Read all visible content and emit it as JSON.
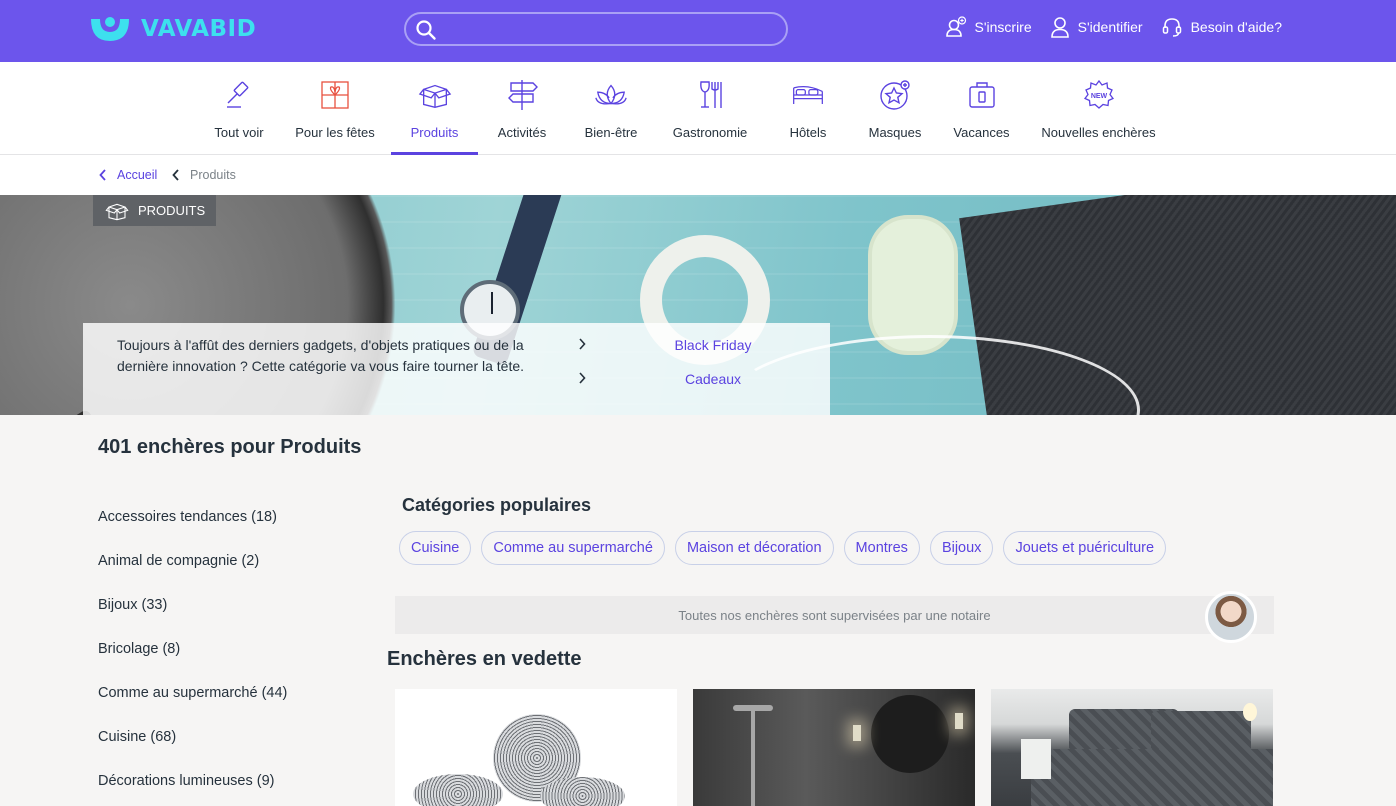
{
  "header": {
    "brand": "VAVABID",
    "search": {
      "value": "",
      "placeholder": ""
    },
    "actions": [
      {
        "label": "S'inscrire",
        "icon": "user-plus-icon"
      },
      {
        "label": "S'identifier",
        "icon": "user-icon"
      },
      {
        "label": "Besoin d'aide?",
        "icon": "headset-icon"
      }
    ]
  },
  "categories": [
    {
      "label": "Tout voir",
      "icon": "gavel-icon"
    },
    {
      "label": "Pour les fêtes",
      "icon": "gift-icon"
    },
    {
      "label": "Produits",
      "icon": "box-icon",
      "active": true
    },
    {
      "label": "Activités",
      "icon": "signpost-icon"
    },
    {
      "label": "Bien-être",
      "icon": "lotus-icon"
    },
    {
      "label": "Gastronomie",
      "icon": "wine-cutlery-icon"
    },
    {
      "label": "Hôtels",
      "icon": "bed-icon"
    },
    {
      "label": "Masques",
      "icon": "star-badge-icon"
    },
    {
      "label": "Vacances",
      "icon": "suitcase-icon"
    },
    {
      "label": "Nouvelles enchères",
      "icon": "new-badge-icon"
    }
  ],
  "breadcrumb": [
    {
      "label": "Accueil"
    },
    {
      "label": "Produits"
    }
  ],
  "hero": {
    "badge": "PRODUITS",
    "description": "Toujours à l'affût des derniers gadgets, d'objets pratiques ou de la dernière innovation ? Cette catégorie va vous faire tourner la tête.",
    "links": [
      "Black Friday",
      "Cadeaux"
    ]
  },
  "listing": {
    "count_title": "401 enchères pour Produits"
  },
  "sidebar": {
    "items": [
      "Accessoires tendances (18)",
      "Animal de compagnie (2)",
      "Bijoux (33)",
      "Bricolage (8)",
      "Comme au supermarché (44)",
      "Cuisine (68)",
      "Décorations lumineuses (9)"
    ]
  },
  "popular": {
    "title": "Catégories populaires",
    "chips": [
      "Cuisine",
      "Comme au supermarché",
      "Maison et décoration",
      "Montres",
      "Bijoux",
      "Jouets et puériculture"
    ]
  },
  "notaire_text": "Toutes nos enchères sont supervisées par une notaire",
  "featured_title": "Enchères en vedette",
  "colors": {
    "brand": "#6c55ec",
    "accent": "#5b43e0",
    "logo": "#3de0ee"
  }
}
